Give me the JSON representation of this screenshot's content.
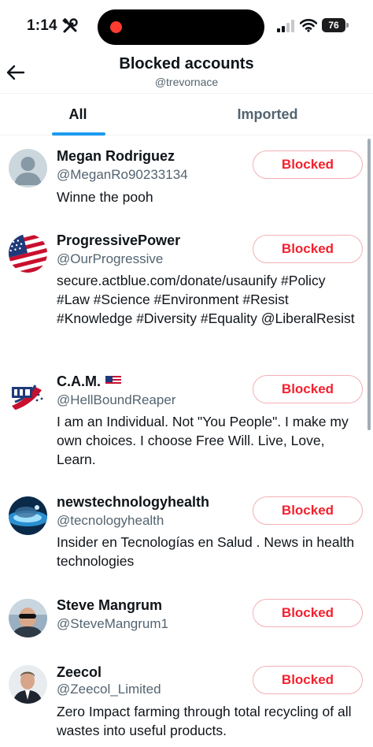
{
  "status_bar": {
    "time": "1:14",
    "battery": "76"
  },
  "header": {
    "title": "Blocked accounts",
    "subtitle": "@trevornace"
  },
  "tabs": [
    {
      "label": "All"
    },
    {
      "label": "Imported"
    }
  ],
  "accounts": [
    {
      "name": "Megan Rodriguez",
      "handle": "@MeganRo90233134",
      "bio": "Winne the pooh",
      "button": "Blocked"
    },
    {
      "name": "ProgressivePower",
      "handle": "@OurProgressive",
      "bio": "secure.actblue.com/donate/usaunify #Policy #Law #Science #Environment #Resist #Knowledge #Diversity #Equality @LiberalResist",
      "button": "Blocked"
    },
    {
      "name": "C.A.M.",
      "handle": "@HellBoundReaper",
      "bio": "I am an Individual. Not \"You People\". I make my own choices. I choose Free Will. Live, Love, Learn.",
      "button": "Blocked"
    },
    {
      "name": "newstechnologyhealth",
      "handle": "@tecnologyhealth",
      "bio": "Insider en Tecnologías en Salud . News in health technologies",
      "button": "Blocked"
    },
    {
      "name": "Steve Mangrum",
      "handle": "@SteveMangrum1",
      "bio": "",
      "button": "Blocked"
    },
    {
      "name": "Zeecol",
      "handle": "@Zeecol_Limited",
      "bio": "Zero Impact farming through total recycling of all wastes into useful products.",
      "button": "Blocked"
    }
  ],
  "colors": {
    "accent": "#1d9bf0",
    "blocked_red": "#f4212e",
    "secondary_text": "#536471"
  }
}
